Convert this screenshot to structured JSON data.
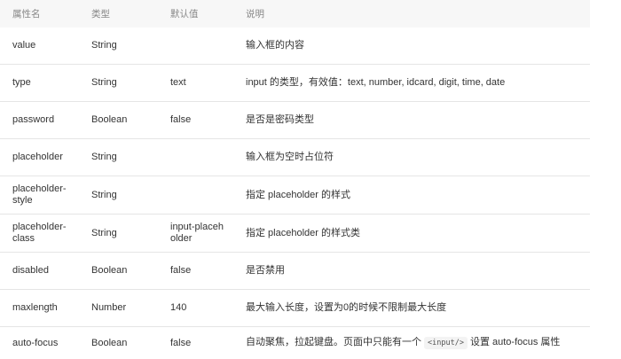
{
  "table": {
    "headers": [
      "属性名",
      "类型",
      "默认值",
      "说明"
    ],
    "rows": [
      {
        "name": "value",
        "type": "String",
        "default": "",
        "desc": "输入框的内容"
      },
      {
        "name": "type",
        "type": "String",
        "default": "text",
        "desc": "input 的类型，有效值：text, number, idcard, digit, time, date"
      },
      {
        "name": "password",
        "type": "Boolean",
        "default": "false",
        "desc": "是否是密码类型"
      },
      {
        "name": "placeholder",
        "type": "String",
        "default": "",
        "desc": "输入框为空时占位符"
      },
      {
        "name": "placeholder-style",
        "type": "String",
        "default": "",
        "desc": "指定 placeholder 的样式"
      },
      {
        "name": "placeholder-class",
        "type": "String",
        "default": "input-placeholder",
        "desc": "指定 placeholder 的样式类"
      },
      {
        "name": "disabled",
        "type": "Boolean",
        "default": "false",
        "desc": "是否禁用"
      },
      {
        "name": "maxlength",
        "type": "Number",
        "default": "140",
        "desc": "最大输入长度，设置为0的时候不限制最大长度"
      },
      {
        "name": "auto-focus",
        "type": "Boolean",
        "default": "false",
        "desc_before": "自动聚焦，拉起键盘。页面中只能有一个",
        "desc_code": "<input/>",
        "desc_after": "设置 auto-focus 属性"
      }
    ]
  }
}
